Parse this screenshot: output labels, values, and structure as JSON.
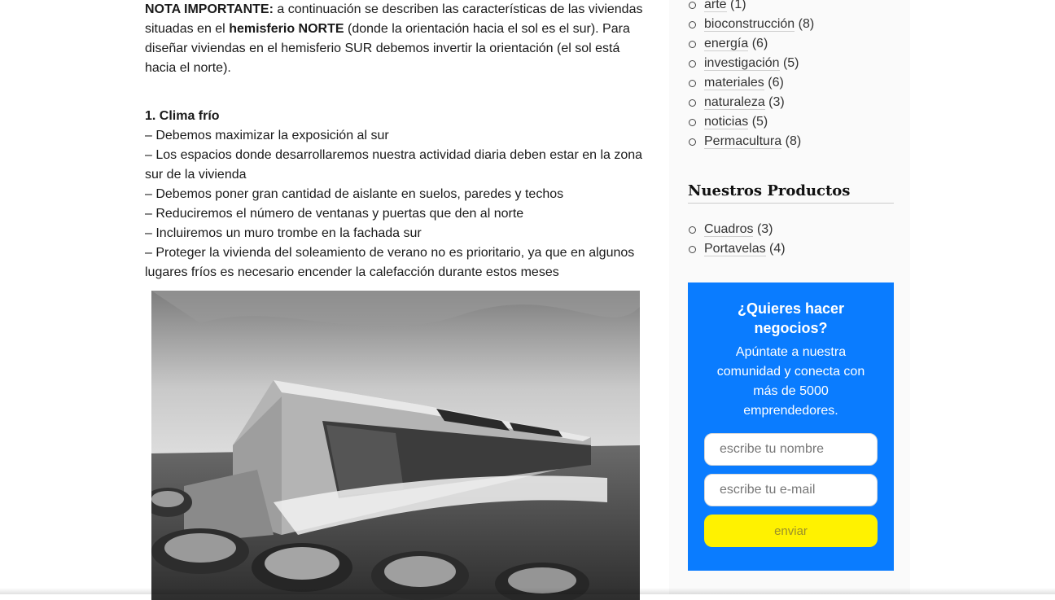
{
  "article": {
    "note": {
      "label": "NOTA IMPORTANTE:",
      "text_1": " a continuación se describen las características de las viviendas situadas en el ",
      "emphasis": "hemisferio NORTE",
      "text_2": " (donde la orientación hacia el sol es el sur). Para diseñar viviendas en el hemisferio SUR debemos invertir la orientación (el sol está hacia el norte)."
    },
    "section_title": "1. Clima frío",
    "bullets": [
      "– Debemos maximizar la exposición al sur",
      "– Los espacios donde desarrollaremos nuestra actividad diaria deben estar en la zona sur de la vivienda",
      "– Debemos poner gran cantidad de aislante en suelos, paredes y techos",
      "– Reduciremos el número de ventanas y puertas que den al norte",
      "– Incluiremos un muro trombe en la fachada sur",
      "– Proteger la vivienda del soleamiento de verano no es prioritario, ya que en algunos lugares fríos es necesario encender la calefacción durante estos meses"
    ]
  },
  "sidebar": {
    "categories": [
      {
        "label": "arte",
        "count": "(1)"
      },
      {
        "label": "bioconstrucción",
        "count": "(8)"
      },
      {
        "label": "energía",
        "count": "(6)"
      },
      {
        "label": "investigación",
        "count": "(5)"
      },
      {
        "label": "materiales",
        "count": "(6)"
      },
      {
        "label": "naturaleza",
        "count": "(3)"
      },
      {
        "label": "noticias",
        "count": "(5)"
      },
      {
        "label": "Permacultura",
        "count": "(8)"
      }
    ],
    "products_title": "Nuestros Productos",
    "products": [
      {
        "label": "Cuadros",
        "count": "(3)"
      },
      {
        "label": "Portavelas",
        "count": "(4)"
      }
    ]
  },
  "cta": {
    "title": "¿Quieres hacer negocios?",
    "text": "Apúntate a nuestra comunidad y conecta con más de 5000 emprendedores.",
    "name_placeholder": "escribe tu nombre",
    "email_placeholder": "escribe tu e-mail",
    "button_label": "enviar"
  },
  "colors": {
    "cta_background": "#0a7cff",
    "button_background": "#fff200"
  },
  "icons": {
    "bullet": "circle-bullet-icon"
  }
}
